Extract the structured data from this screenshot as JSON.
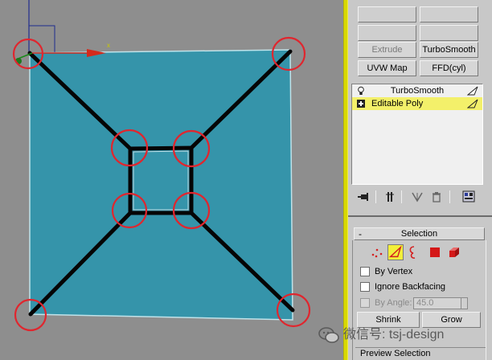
{
  "viewport": {
    "axis_x_label": "x",
    "colors": {
      "poly": "#3594aa",
      "edge": "#050505",
      "circle": "#e0262e",
      "gizmo": "#1f2c8f",
      "axis_y": "#1a8a1a"
    }
  },
  "panel": {
    "buttons": {
      "blank1": "",
      "blank2": "",
      "blank3": "",
      "blank4": "",
      "extrude": "Extrude",
      "turbosmooth": "TurboSmooth",
      "uvw_map": "UVW Map",
      "ffd_cyl": "FFD(cyl)"
    },
    "stack": [
      {
        "label": "TurboSmooth",
        "lead_icon": "bulb-icon",
        "selected": false
      },
      {
        "label": "Editable Poly",
        "lead_icon": "plus-box-icon",
        "selected": true
      }
    ],
    "toolrow_icons": [
      "pin-stack-icon",
      "show-end-result-icon",
      "make-unique-icon",
      "remove-modifier-icon",
      "configure-sets-icon"
    ],
    "selection": {
      "title": "Selection",
      "collapse_symbol": "-",
      "levels": [
        "vertex-icon",
        "edge-icon",
        "border-icon",
        "polygon-icon",
        "element-icon"
      ],
      "active_level": "edge-icon",
      "by_vertex": "By Vertex",
      "ignore_backfacing": "Ignore Backfacing",
      "by_angle": "By Angle:",
      "angle_value": "45.0",
      "shrink": "Shrink",
      "grow": "Grow",
      "preview_label": "Preview Selection"
    }
  },
  "watermark": {
    "text": "微信号: tsj-design",
    "icon": "wechat-icon"
  }
}
